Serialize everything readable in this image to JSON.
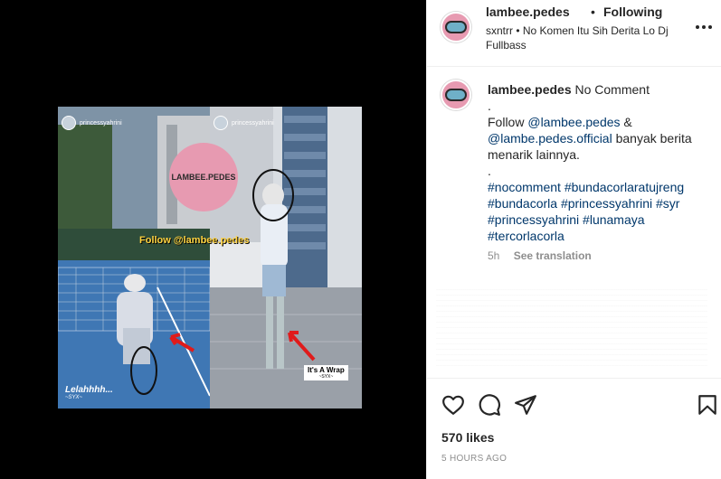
{
  "media": {
    "story_user_left": "princessyahrini",
    "story_user_right": "princessyahrini",
    "logo_text": "LAMBEE.PEDES",
    "follow_overlay": "Follow @lambee.pedes",
    "caption_left": "Lelahhhh...",
    "caption_left_sub": "~SYX~",
    "caption_right": "It's A Wrap",
    "caption_right_sub": "~SYX~"
  },
  "header": {
    "username": "lambee.pedes",
    "separator": "•",
    "follow_status": "Following",
    "music": "sxntrr • No Komen Itu Sih Derita Lo Dj Fullbass"
  },
  "comment": {
    "username": "lambee.pedes",
    "first_line": "No Comment",
    "line_dot_1": ".",
    "follow_text_1": "Follow",
    "mention_1": "@lambee.pedes",
    "follow_text_2": "&",
    "mention_2": "@lambe.pedes.official",
    "follow_text_3": "banyak berita menarik lainnya.",
    "line_dot_2": ".",
    "hashtags": "#nocomment #bundacorlaratujreng #bundacorla #princessyahrini #syr #princessyahrini #lunamaya #tercorlacorla",
    "time": "5h",
    "see_translation": "See translation"
  },
  "actions": {
    "likes": "570 likes",
    "time_ago": "5 HOURS AGO"
  },
  "icons": {
    "like": "heart-icon",
    "comment": "comment-bubble-icon",
    "share": "paper-plane-icon",
    "save": "bookmark-icon",
    "more": "more-horizontal-icon"
  }
}
